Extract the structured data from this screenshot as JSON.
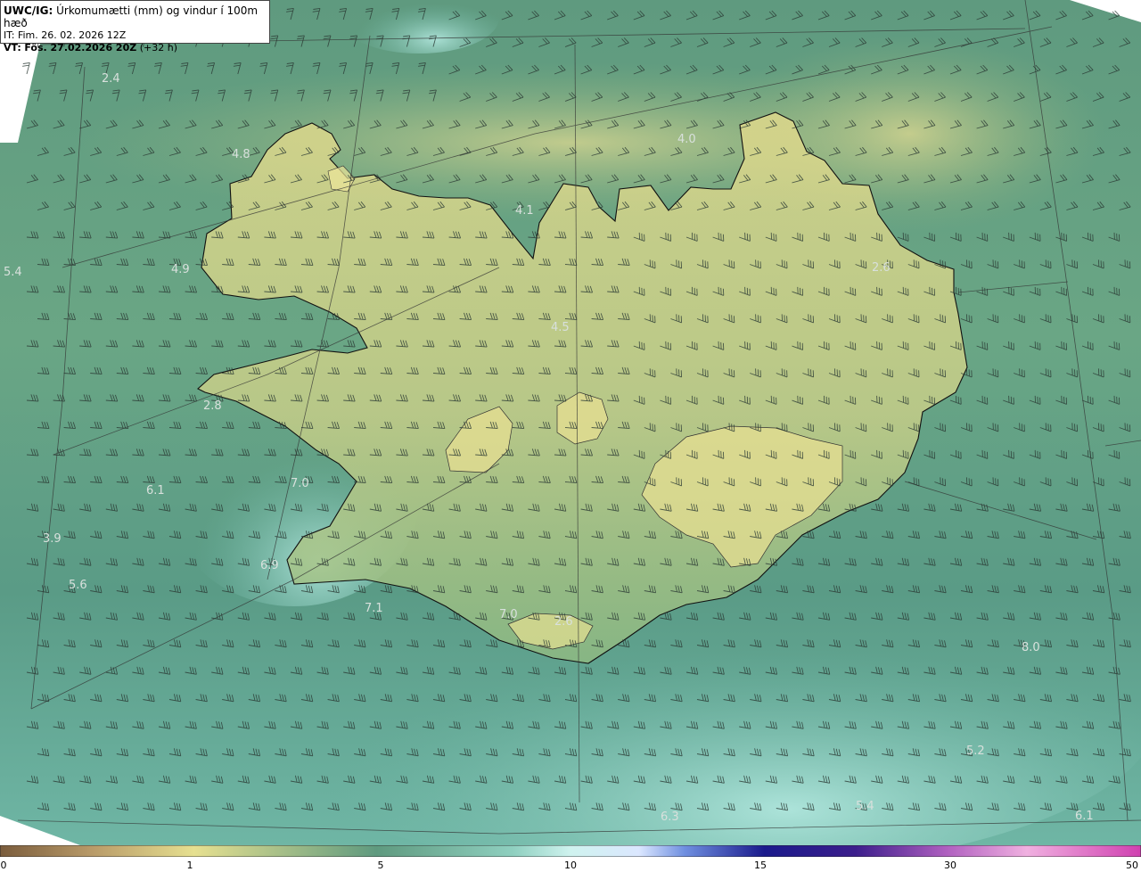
{
  "header": {
    "model_label": "UWC/IG:",
    "title": "Úrkomumætti (mm) og vindur í 100m hæð",
    "initial_time": "IT: Fim. 26. 02. 2026 12Z",
    "valid_label": "VT:",
    "valid_time": "Fös. 27.02.2026 20Z",
    "lead": "(+32 h)"
  },
  "map_labels": [
    {
      "text": "2.4"
    },
    {
      "text": "4.8"
    },
    {
      "text": "4.0"
    },
    {
      "text": "4.1"
    },
    {
      "text": "5.4"
    },
    {
      "text": "4.9"
    },
    {
      "text": "4.5"
    },
    {
      "text": "2.6"
    },
    {
      "text": "2.8"
    },
    {
      "text": "7.0"
    },
    {
      "text": "6.1"
    },
    {
      "text": "3.9"
    },
    {
      "text": "5.6"
    },
    {
      "text": "6.9"
    },
    {
      "text": "7.1"
    },
    {
      "text": "7.0"
    },
    {
      "text": "2.6"
    },
    {
      "text": "8.0"
    },
    {
      "text": "5.2"
    },
    {
      "text": "6.3"
    },
    {
      "text": "5.4"
    },
    {
      "text": "6.1"
    }
  ],
  "colorbar": {
    "ticks": [
      "0",
      "1",
      "5",
      "10",
      "15",
      "30",
      "50"
    ],
    "colors": [
      "#7a5c3c",
      "#b89a68",
      "#e6e090",
      "#5f9a7f",
      "#a6e3dc",
      "#dbe7ff",
      "#6f8fe0",
      "#1a1a8c",
      "#3c1e8c",
      "#b060c0",
      "#f0b0e0",
      "#d040b0"
    ]
  },
  "colors": {
    "sea": "#5f9a7f",
    "land_dry": "#e2dc8e",
    "land_wet": "#a9c486",
    "coast": "#111111"
  }
}
